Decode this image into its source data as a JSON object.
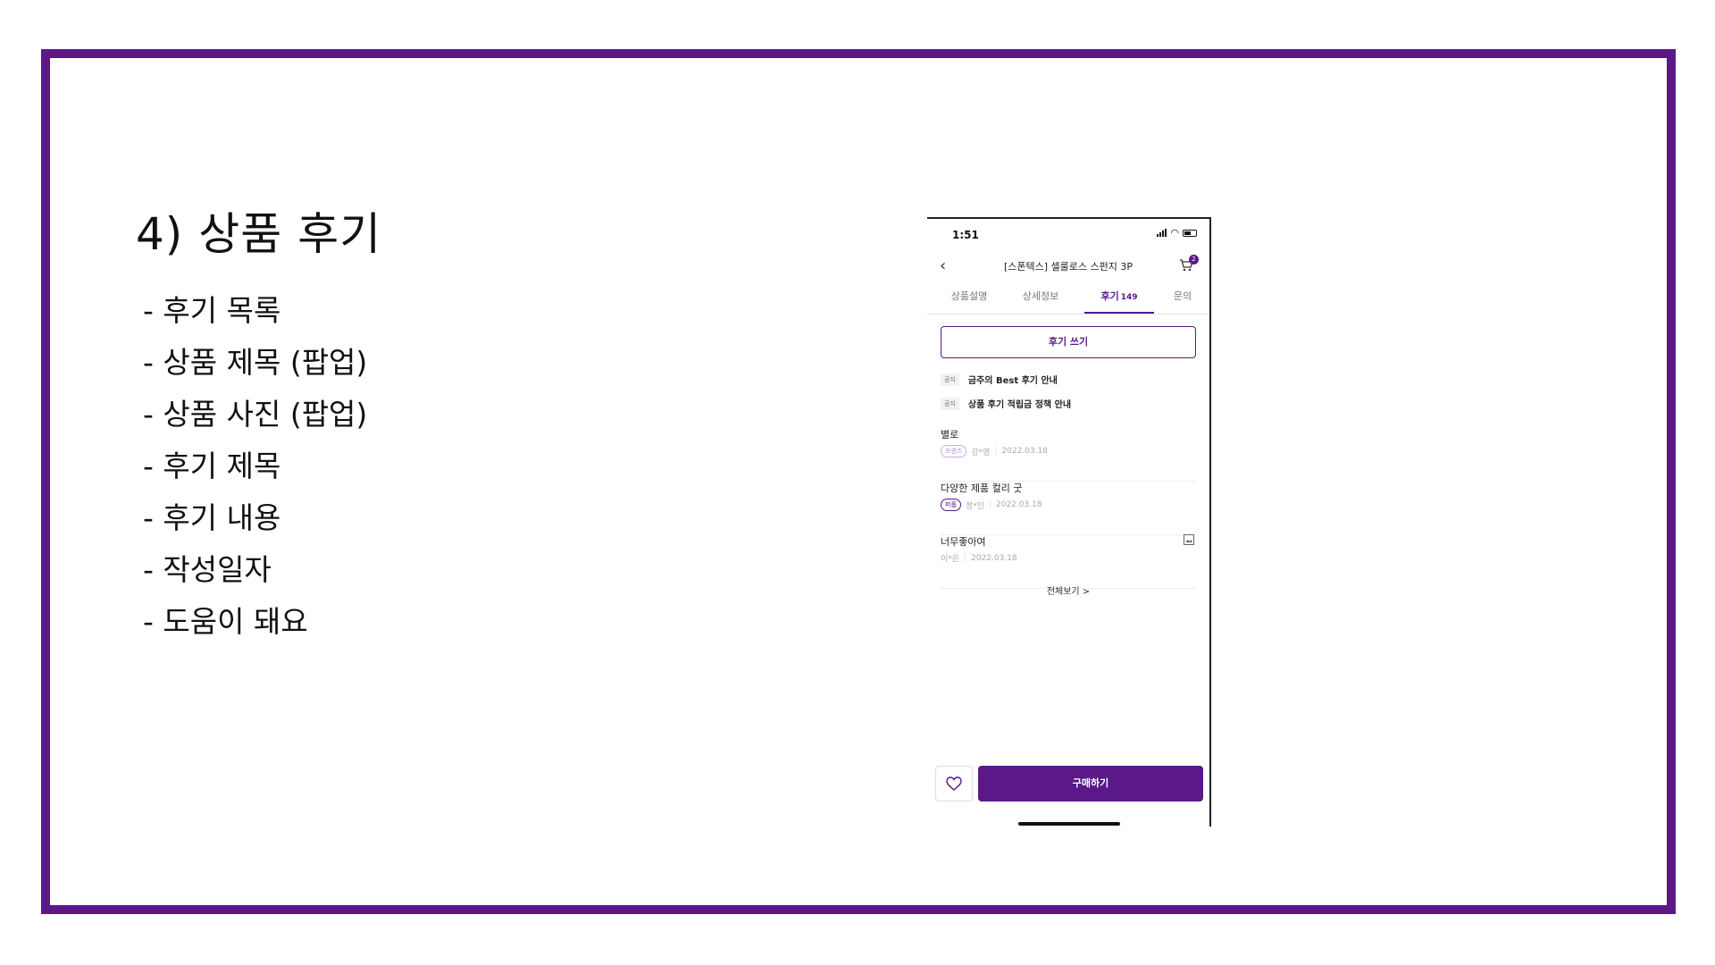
{
  "slide": {
    "title": "4)  상품 후기",
    "bullets": [
      "- 후기 목록",
      "- 상품 제목 (팝업)",
      "- 상품 사진 (팝업)",
      "- 후기 제목",
      "- 후기 내용",
      "- 작성일자",
      "- 도움이 돼요"
    ],
    "frame_color": "#5a1889"
  },
  "phone": {
    "status": {
      "time": "1:51"
    },
    "nav": {
      "back_icon": "chevron-left-icon",
      "title": "[스폰텍스] 셀룰로스 스펀지 3P",
      "cart_icon": "cart-icon",
      "cart_count": "2"
    },
    "tabs": [
      {
        "label": "상품설명"
      },
      {
        "label": "상세정보"
      },
      {
        "label": "후기",
        "count": "149",
        "active": true
      },
      {
        "label": "문의"
      }
    ],
    "write_review_label": "후기 쓰기",
    "notices": [
      {
        "tag": "공지",
        "text": "금주의 Best 후기 안내"
      },
      {
        "tag": "공지",
        "text": "상품 후기 적립금 정책 안내"
      }
    ],
    "reviews": [
      {
        "title": "별로",
        "grade": "프렌즈",
        "author": "강*영",
        "date": "2022.03.18"
      },
      {
        "title": "다양한 제품 컬리 굿",
        "grade": "퍼플",
        "author": "정*인",
        "date": "2022.03.18"
      },
      {
        "title": "너무좋아여",
        "author": "이*은",
        "date": "2022.03.18",
        "has_photo": true
      }
    ],
    "view_all_label": "전체보기 >",
    "buy_label": "구매하기",
    "wish_icon": "heart-icon",
    "accent_color": "#5a1889"
  }
}
